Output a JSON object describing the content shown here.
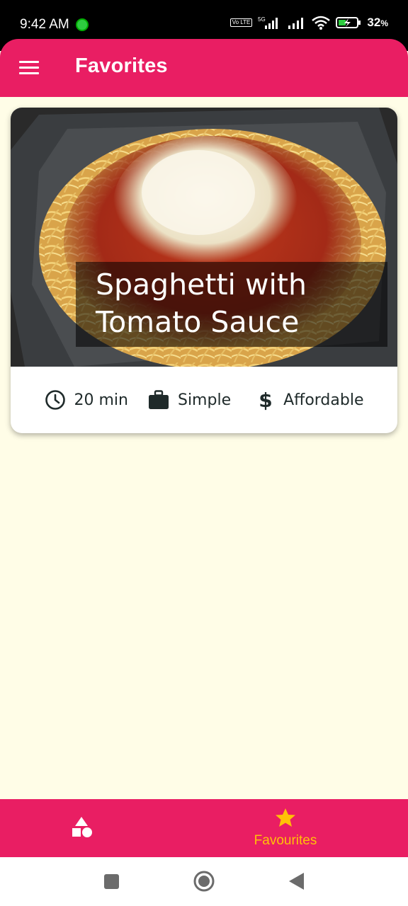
{
  "status_bar": {
    "time": "9:42 AM",
    "network": "5G",
    "volte": "Vo LTE",
    "battery": "32",
    "battery_unit": "%"
  },
  "app_bar": {
    "title": "Favorites"
  },
  "meal": {
    "title": "Spaghetti with Tomato Sauce",
    "duration": "20 min",
    "complexity": "Simple",
    "affordability": "Affordable"
  },
  "bottom_nav": {
    "items": [
      {
        "icon": "category-icon",
        "label": ""
      },
      {
        "icon": "star-icon",
        "label": "Favourites",
        "active": true
      }
    ]
  },
  "colors": {
    "primary": "#e91e63",
    "accent": "#ffc107",
    "background": "#fffde7"
  }
}
